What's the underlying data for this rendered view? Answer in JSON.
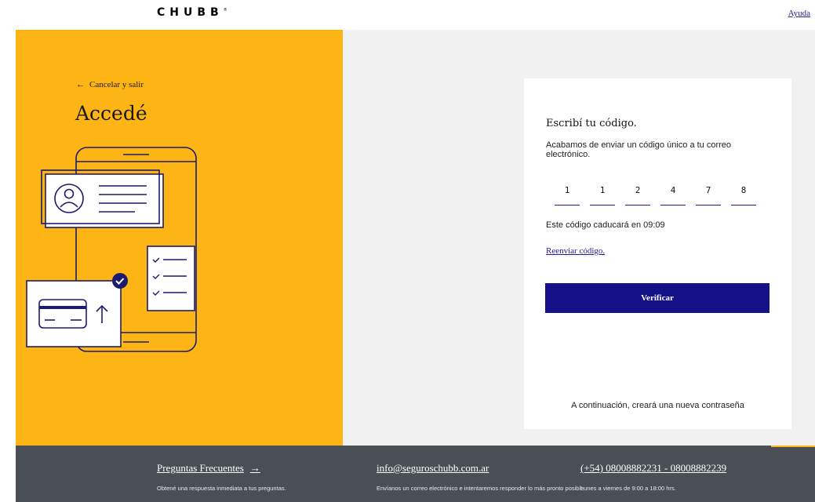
{
  "header": {
    "logo_text": "CHUBB",
    "logo_mark": "®",
    "help_label": "Ayuda"
  },
  "left": {
    "back_label": "Cancelar y salir",
    "title": "Accedé"
  },
  "card": {
    "title": "Escribí tu código.",
    "description": "Acabamos de enviar un código único a tu correo electrónico.",
    "code_digits": [
      "1",
      "1",
      "2",
      "4",
      "7",
      "8"
    ],
    "expiry_text": "Este código caducará en 09:09",
    "resend_label": "Reenviar código.",
    "verify_label": "Verificar",
    "next_note": "A continuación, creará una nueva contraseña"
  },
  "footer": {
    "faq_label": "Preguntas Frecuentes",
    "faq_text": "Obtené una respuesta inmediata a tus preguntas.",
    "email_label": "info@seguroschubb.com.ar",
    "email_text": "Envíanos un correo electrónico e intentaremos responder lo más pronto posible",
    "phone_label": "(+54) 08008882231 - 08008882239",
    "phone_text": "Lunes a viernes de 9:00 a 18:00 hrs."
  },
  "colors": {
    "brand_yellow": "#fdb515",
    "brand_navy": "#151289",
    "footer_gray": "#4a4f55"
  }
}
